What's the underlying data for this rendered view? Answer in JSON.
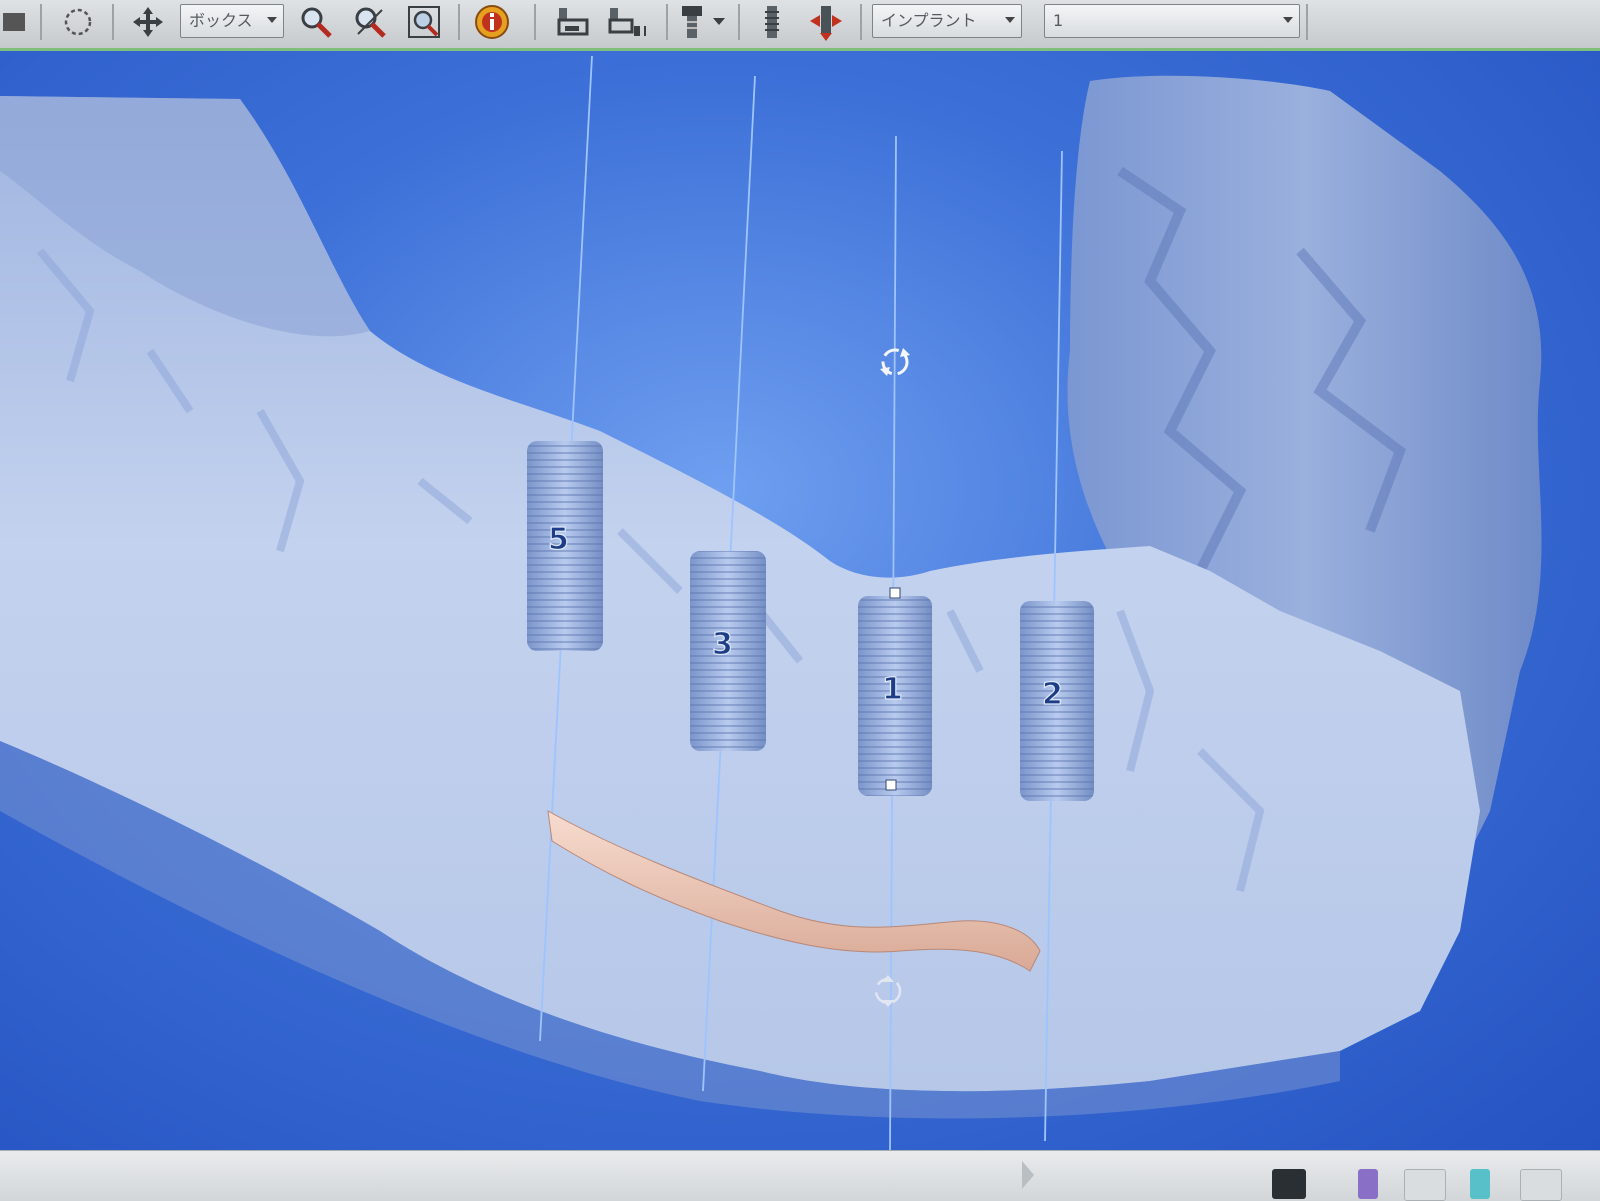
{
  "toolbar": {
    "view_mode_select": {
      "value": "ボックス"
    },
    "object_type_select": {
      "value": "インプラント"
    },
    "object_number_select": {
      "value": "1"
    }
  },
  "icons": [
    "lasso-icon",
    "pan-icon",
    "zoom-in-icon",
    "zoom-out-icon",
    "zoom-fit-icon",
    "info-icon",
    "panoramic-icon",
    "cross-section-icon",
    "implant-add-icon",
    "implant-dropdown-icon",
    "nerve-tool-icon",
    "implant-move-icon",
    "rotate-handle-icon"
  ],
  "implants": [
    {
      "label": "5"
    },
    {
      "label": "3"
    },
    {
      "label": "1",
      "selected": true
    },
    {
      "label": "2"
    }
  ],
  "colors": {
    "viewport_background": "#3c6fd7",
    "bone": "#c4d2ec",
    "implant": "#8aa6d6",
    "nerve_canal": "#f2c9b8",
    "implant_axis": "#9ec4ff",
    "toolbar": "#d2d6d9",
    "selection_underline": "#7fbf7a"
  }
}
